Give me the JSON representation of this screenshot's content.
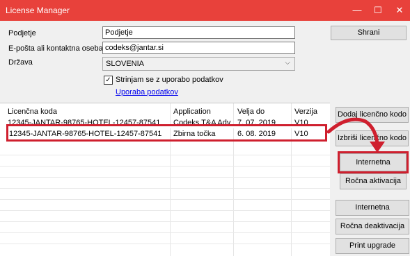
{
  "window": {
    "title": "License Manager"
  },
  "controls": {
    "minimize": "—",
    "maximize": "☐",
    "close": "✕"
  },
  "form": {
    "company_label": "Podjetje",
    "company_value": "Podjetje",
    "email_label": "E-pošta ali kontaktna oseba",
    "email_value": "codeks@jantar.si",
    "country_label": "Država",
    "country_value": "SLOVENIA",
    "consent_label": "Strinjam se z uporabo podatkov",
    "consent_checked": "✓",
    "usage_link": "Uporaba podatkov",
    "save_button": "Shrani"
  },
  "table": {
    "columns": [
      "Licenčna koda",
      "Application",
      "Velja do",
      "Verzija"
    ],
    "rows": [
      [
        "12345-JANTAR-98765-HOTEL-12457-87541",
        "Codeks T&A Adv",
        "7. 07. 2019",
        "V10"
      ],
      [
        "12345-JANTAR-98765-HOTEL-12457-87541",
        "Zbirna točka",
        "6. 08. 2019",
        "V10"
      ]
    ]
  },
  "actions": {
    "add_license": "Dodaj licenčno kodo",
    "delete_license": "Izbriši licenčno kodo",
    "internet_activation": "Internetna aktivacija",
    "manual_activation": "Ročna aktivacija",
    "internet_deactivation": "Internetna deaktivacija",
    "manual_deactivation": "Ročna deaktivacija",
    "print_upgrade": "Print upgrade request"
  },
  "colors": {
    "titlebar": "#e8413b",
    "highlight": "#cf1f2e"
  }
}
